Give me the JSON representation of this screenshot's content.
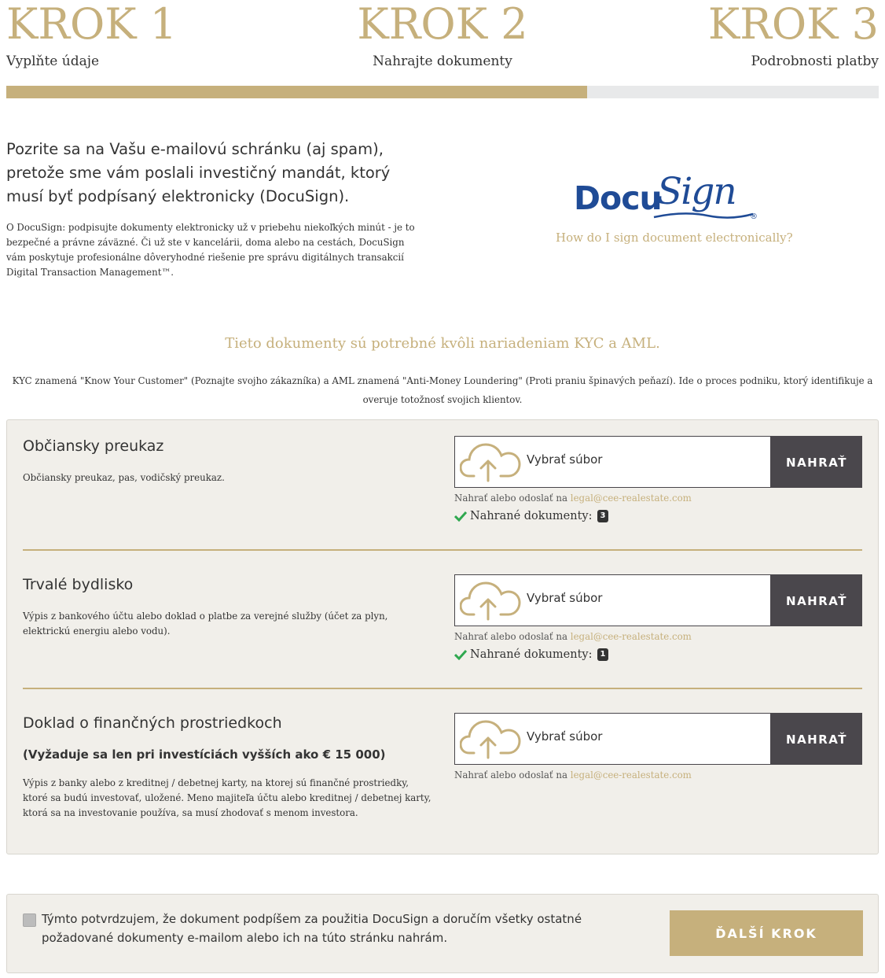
{
  "steps": [
    {
      "number": "KROK 1",
      "label": "Vyplňte údaje"
    },
    {
      "number": "KROK 2",
      "label": "Nahrajte dokumenty"
    },
    {
      "number": "KROK 3",
      "label": "Podrobnosti platby"
    }
  ],
  "progress_fraction": 0.666,
  "colors": {
    "accent": "#c6b07c",
    "dark": "#4a474c",
    "panel": "#f1efea",
    "docusign_blue": "#1f4b96",
    "check_green": "#2fa84f"
  },
  "intro": {
    "title": "Pozrite sa na Vašu e-mailovú schránku (aj spam), pretože sme vám poslali investičný mandát, ktorý musí byť podpísaný elektronicky (DocuSign).",
    "text": "O DocuSign: podpisujte dokumenty elektronicky už v priebehu niekoľkých minút - je to bezpečné a právne záväzné. Či už ste v kancelárii, doma alebo na cestách, DocuSign vám poskytuje profesionálne dôveryhodné riešenie pre správu digitálnych transakcií Digital Transaction Management™."
  },
  "docusign": {
    "logo_docu": "Docu",
    "logo_sign": "Sign",
    "reg": "®",
    "help_link": "How do I sign document electronically?"
  },
  "kyc": {
    "title": "Tieto dokumenty sú potrebné kvôli nariadeniam KYC a AML.",
    "text": "KYC znamená \"Know Your Customer\" (Poznajte svojho zákazníka) a AML znamená \"Anti-Money Loundering\" (Proti praniu špinavých peňazí). Ide o proces podniku, ktorý identifikuje a overuje totožnosť svojich klientov."
  },
  "upload": {
    "choose_label": "Vybrať súbor",
    "button_label": "NAHRAŤ",
    "or_mail_prefix": "Nahrať alebo odoslať na",
    "email": "legal@cee-realestate.com",
    "uploaded_label": "Nahrané dokumenty:"
  },
  "documents": [
    {
      "title": "Občiansky preukaz",
      "description": "Občiansky preukaz, pas, vodičský preukaz.",
      "uploaded_count": "3"
    },
    {
      "title": "Trvalé bydlisko",
      "description": "Výpis z bankového účtu alebo doklad o platbe za verejné služby (účet za plyn, elektrickú energiu alebo vodu).",
      "uploaded_count": "1"
    },
    {
      "title": "Doklad o finančných prostriedkoch",
      "note": "(Vyžaduje sa len pri investíciách vyšších ako € 15 000)",
      "description": "Výpis z banky alebo z kreditnej / debetnej karty, na ktorej sú finančné prostriedky, ktoré sa budú investovať, uložené. Meno majiteľa účtu alebo kreditnej / debetnej karty, ktorá sa na investovanie používa, sa musí zhodovať s menom investora."
    }
  ],
  "confirm": {
    "text": "Týmto potvrdzujem, že dokument podpíšem za použitia DocuSign a doručím všetky ostatné požadované dokumenty e-mailom alebo ich na túto stránku nahrám.",
    "checked": false,
    "next_label": "ĎALŠÍ KROK"
  }
}
